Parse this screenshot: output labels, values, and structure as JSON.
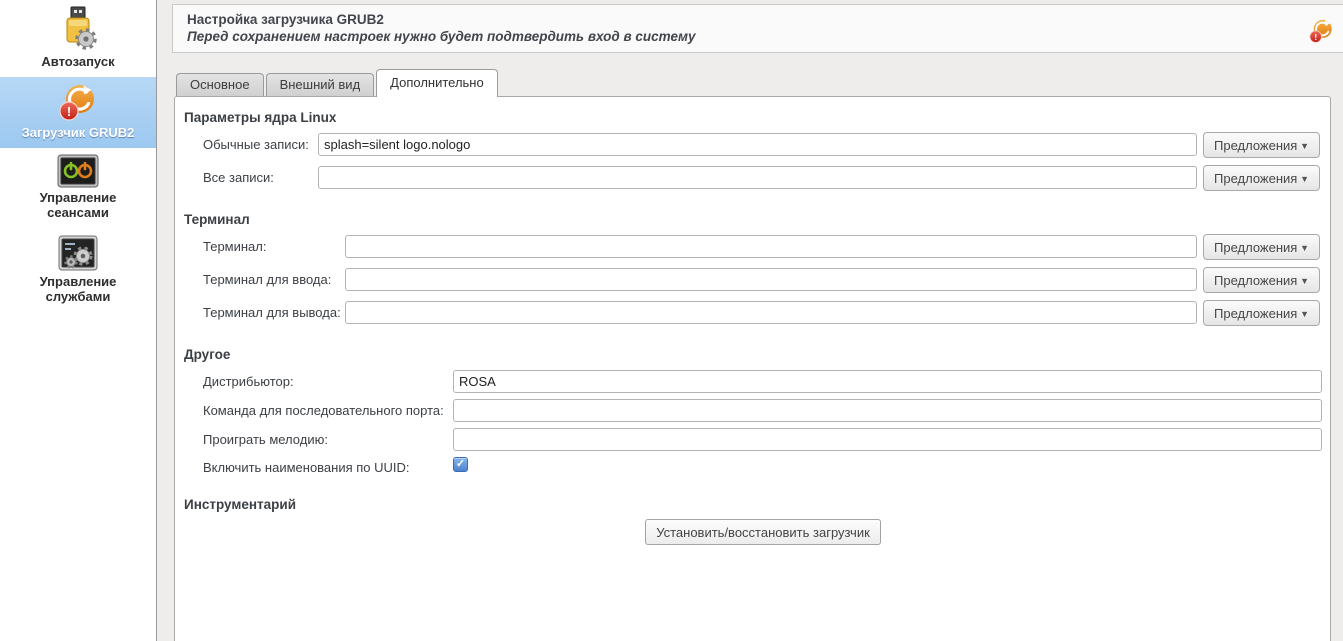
{
  "sidebar": {
    "items": [
      {
        "label": "Автозапуск",
        "icon": "autostart-icon",
        "selected": false
      },
      {
        "label": "Загрузчик GRUB2",
        "icon": "grub2-icon",
        "selected": true
      },
      {
        "label": "Управление сеансами",
        "icon": "sessions-icon",
        "selected": false
      },
      {
        "label": "Управление службами",
        "icon": "services-icon",
        "selected": false
      }
    ]
  },
  "header": {
    "title": "Настройка загрузчика GRUB2",
    "subtitle": "Перед сохранением настроек нужно будет подтвердить вход в систему",
    "app_icon": "grub2-icon"
  },
  "tabs": [
    {
      "label": "Основное",
      "active": false
    },
    {
      "label": "Внешний вид",
      "active": false
    },
    {
      "label": "Дополнительно",
      "active": true
    }
  ],
  "form": {
    "kernel_section": {
      "title": "Параметры ядра Linux",
      "rows": [
        {
          "label": "Обычные записи:",
          "value": "splash=silent logo.nologo",
          "suggest_label": "Предложения"
        },
        {
          "label": "Все записи:",
          "value": "",
          "suggest_label": "Предложения"
        }
      ]
    },
    "terminal_section": {
      "title": "Терминал",
      "rows": [
        {
          "label": "Терминал:",
          "value": "",
          "suggest_label": "Предложения"
        },
        {
          "label": "Терминал для ввода:",
          "value": "",
          "suggest_label": "Предложения"
        },
        {
          "label": "Терминал для вывода:",
          "value": "",
          "suggest_label": "Предложения"
        }
      ]
    },
    "other_section": {
      "title": "Другое",
      "rows": [
        {
          "label": "Дистрибьютор:",
          "value": "ROSA"
        },
        {
          "label": "Команда для последовательного порта:",
          "value": ""
        },
        {
          "label": "Проиграть мелодию:",
          "value": ""
        }
      ],
      "checkbox_row": {
        "label": "Включить наименования по UUID:",
        "checked": true
      }
    },
    "tools_section": {
      "title": "Инструментарий",
      "button_label": "Установить/восстановить загрузчик"
    }
  },
  "icons": {
    "chevron_down": "▼",
    "check": "✓",
    "exclamation": "!"
  },
  "colors": {
    "selection_blue": "#a6cef2",
    "checkbox_blue": "#4f82cf",
    "grub_orange": "#ef8d13",
    "badge_red": "#d42a2a",
    "panel_border": "#a9a9a9"
  }
}
